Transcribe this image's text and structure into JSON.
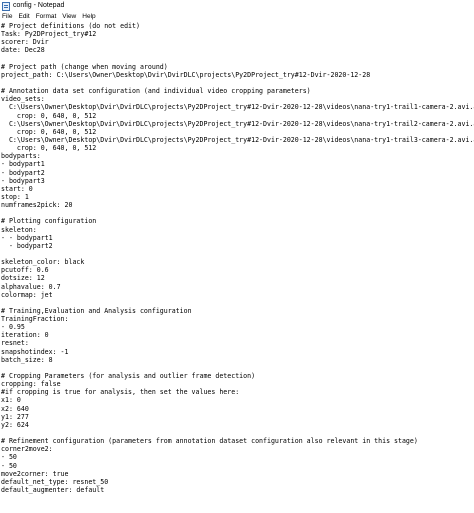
{
  "window": {
    "title": "config - Notepad"
  },
  "menu": {
    "items": [
      "File",
      "Edit",
      "Format",
      "View",
      "Help"
    ]
  },
  "editor": {
    "lines": [
      "# Project definitions (do not edit)",
      "Task: Py2DProject_try#12",
      "scorer: Dvir",
      "date: Dec28",
      "",
      "# Project path (change when moving around)",
      "project_path: C:\\Users\\Owner\\Desktop\\Dvir\\DvirDLC\\projects\\Py2DProject_try#12-Dvir-2020-12-28",
      "",
      "# Annotation data set configuration (and individual video cropping parameters)",
      "video_sets:",
      "  C:\\Users\\Owner\\Desktop\\Dvir\\DvirDLC\\projects\\Py2DProject_try#12-Dvir-2020-12-28\\videos\\nana-try1-trail1-camera-2.avi.avi:",
      "    crop: 0, 640, 0, 512",
      "  C:\\Users\\Owner\\Desktop\\Dvir\\DvirDLC\\projects\\Py2DProject_try#12-Dvir-2020-12-28\\videos\\nana-try1-trail2-camera-2.avi.avi:",
      "    crop: 0, 640, 0, 512",
      "  C:\\Users\\Owner\\Desktop\\Dvir\\DvirDLC\\projects\\Py2DProject_try#12-Dvir-2020-12-28\\videos\\nana-try1-trail3-camera-2.avi.avi:",
      "    crop: 0, 640, 0, 512",
      "bodyparts:",
      "- bodypart1",
      "- bodypart2",
      "- bodypart3",
      "start: 0",
      "stop: 1",
      "numframes2pick: 20",
      "",
      "# Plotting configuration",
      "skeleton:",
      "- - bodypart1",
      "  - bodypart2",
      "",
      "skeleton_color: black",
      "pcutoff: 0.6",
      "dotsize: 12",
      "alphavalue: 0.7",
      "colormap: jet",
      "",
      "# Training,Evaluation and Analysis configuration",
      "TrainingFraction:",
      "- 0.95",
      "iteration: 0",
      "resnet:",
      "snapshotindex: -1",
      "batch_size: 8",
      "",
      "# Cropping Parameters (for analysis and outlier frame detection)",
      "cropping: false",
      "#if cropping is true for analysis, then set the values here:",
      "x1: 0",
      "x2: 640",
      "y1: 277",
      "y2: 624",
      "",
      "# Refinement configuration (parameters from annotation dataset configuration also relevant in this stage)",
      "corner2move2:",
      "- 50",
      "- 50",
      "move2corner: true",
      "default_net_type: resnet_50",
      "default_augmenter: default"
    ]
  }
}
